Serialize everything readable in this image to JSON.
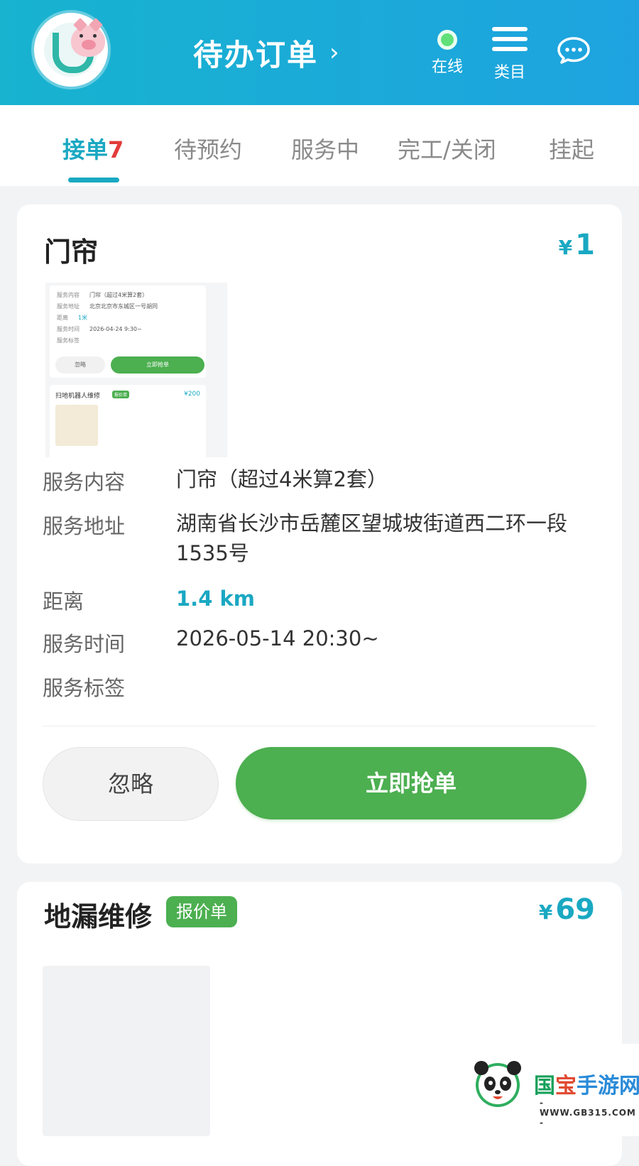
{
  "header": {
    "title": "待办订单",
    "online_label": "在线",
    "category_label": "类目"
  },
  "tabs": [
    {
      "label": "接单",
      "count": "7",
      "active": true
    },
    {
      "label": "待预约"
    },
    {
      "label": "服务中"
    },
    {
      "label": "完工/关闭"
    },
    {
      "label": "挂起"
    }
  ],
  "orders": [
    {
      "title": "门帘",
      "price_symbol": "¥",
      "price": "1",
      "thumbnail": {
        "lines": [
          {
            "label": "服务内容",
            "value": "门帘（超过4米算2套）"
          },
          {
            "label": "服务地址",
            "value": "北京北京市东城区一号胡同"
          },
          {
            "label": "距离",
            "value": "1米"
          },
          {
            "label": "服务时间",
            "value": "2026-04-24 9:30~"
          },
          {
            "label": "服务标签",
            "value": ""
          }
        ],
        "ignore_label": "忽略",
        "grab_label": "立即抢单",
        "next_title": "扫地机器人维修",
        "next_tag": "报价单",
        "next_price": "¥200"
      },
      "fields": [
        {
          "label": "服务内容",
          "value": "门帘（超过4米算2套）"
        },
        {
          "label": "服务地址",
          "value": "湖南省长沙市岳麓区望城坡街道西二环一段1535号"
        },
        {
          "label": "距离",
          "value": "1.4 km"
        },
        {
          "label": "服务时间",
          "value": "2026-05-14 20:30~"
        },
        {
          "label": "服务标签",
          "value": ""
        }
      ],
      "ignore_label": "忽略",
      "grab_label": "立即抢单"
    },
    {
      "title": "地漏维修",
      "badge": "报价单",
      "price_symbol": "¥",
      "price": "69"
    }
  ],
  "watermark": {
    "name_1": "国",
    "name_2": "宝",
    "name_3": "手游网",
    "url": "- WWW.GB315.COM -"
  },
  "colors": {
    "header_start": "#17b3cf",
    "header_end": "#1ea3e0",
    "accent": "#1aa8c2",
    "grab_button": "#4caf50",
    "count_red": "#e23b3b"
  },
  "icons": [
    "app-logo-icon",
    "online-dot-icon",
    "menu-icon",
    "chat-bubble-icon",
    "chevron-right-icon"
  ]
}
